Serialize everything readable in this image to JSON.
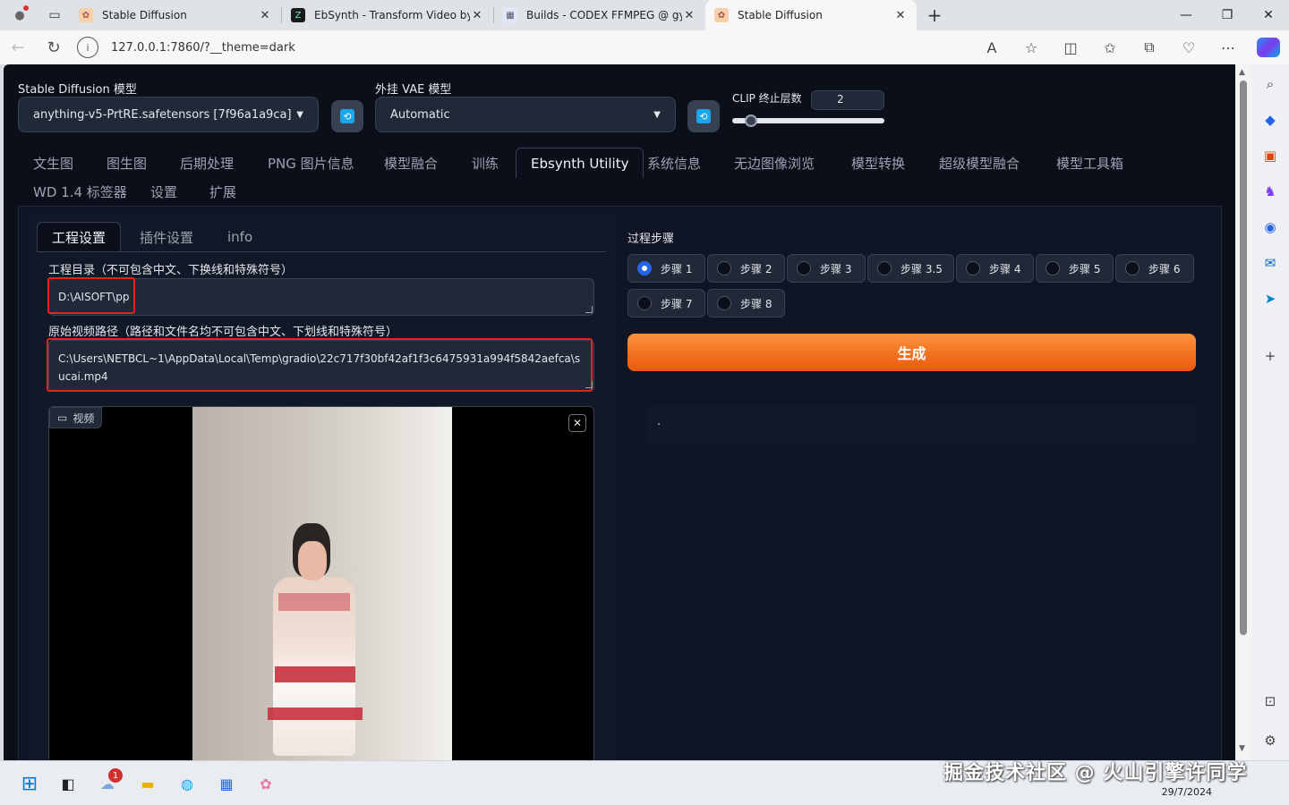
{
  "browser": {
    "tabs": [
      {
        "title": "Stable Diffusion",
        "active": false
      },
      {
        "title": "EbSynth - Transform Video by Pa",
        "active": false
      },
      {
        "title": "Builds - CODEX FFMPEG @ gyan",
        "active": false
      },
      {
        "title": "Stable Diffusion",
        "active": true
      }
    ],
    "url": "127.0.0.1:7860/?__theme=dark"
  },
  "models": {
    "sd_label": "Stable Diffusion 模型",
    "sd_value": "anything-v5-PrtRE.safetensors [7f96a1a9ca]",
    "vae_label": "外挂 VAE 模型",
    "vae_value": "Automatic",
    "clip_label": "CLIP 终止层数",
    "clip_value": "2"
  },
  "main_tabs": [
    "文生图",
    "图生图",
    "后期处理",
    "PNG 图片信息",
    "模型融合",
    "训练",
    "Ebsynth Utility",
    "系统信息",
    "无边图像浏览",
    "模型转换",
    "超级模型融合",
    "模型工具箱",
    "WD 1.4 标签器",
    "设置",
    "扩展"
  ],
  "sub_tabs": [
    "工程设置",
    "插件设置",
    "info"
  ],
  "project": {
    "dir_label": "工程目录（不可包含中文、下换线和特殊符号）",
    "dir_value": "D:\\AISOFT\\pp",
    "video_label": "原始视频路径（路径和文件名均不可包含中文、下划线和特殊符号）",
    "video_value": "C:\\Users\\NETBCL~1\\AppData\\Local\\Temp\\gradio\\22c717f30bf42af1f3c6475931a994f5842aefca\\sucai.mp4",
    "video_component_label": "视频"
  },
  "steps": {
    "label": "过程步骤",
    "options": [
      "步骤 1",
      "步骤 2",
      "步骤 3",
      "步骤 3.5",
      "步骤 4",
      "步骤 5",
      "步骤 6",
      "步骤 7",
      "步骤 8"
    ],
    "selected": "步骤 1"
  },
  "generate_label": "生成",
  "output_text": ".",
  "taskbar": {
    "notification_count": "1",
    "date": "29/7/2024"
  },
  "watermark": "掘金技术社区 @ 火山引擎许同学",
  "colors": {
    "accent": "#ea580c",
    "selection": "#2563eb",
    "highlight_box": "#e02424",
    "background": "#0b0f19"
  }
}
